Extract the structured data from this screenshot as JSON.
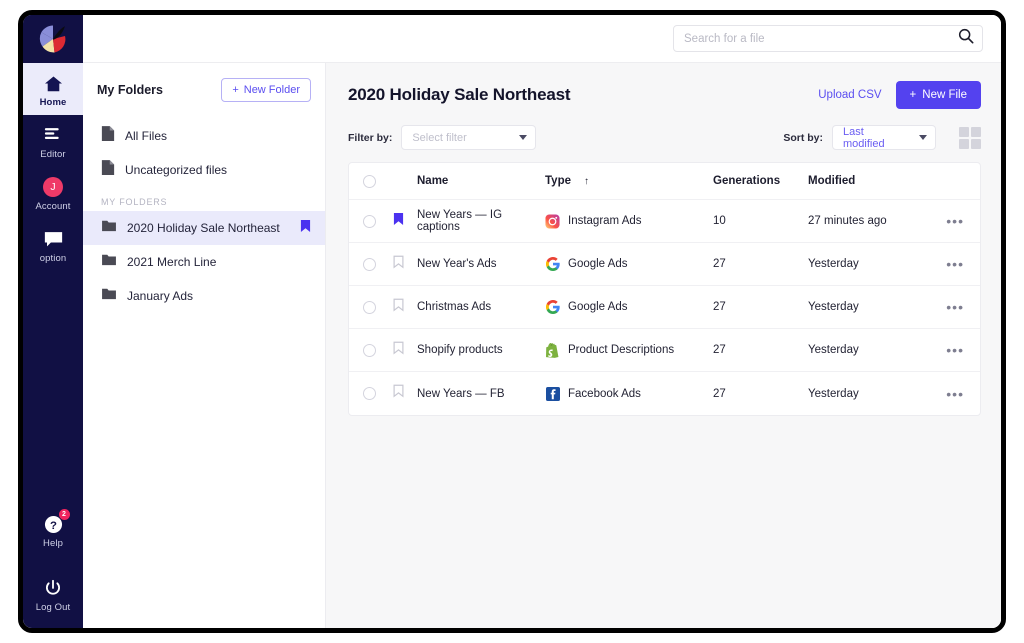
{
  "brand": {
    "logo_name": "app-logo",
    "colors": {
      "rail_bg": "#111044",
      "accent": "#5442ef",
      "accent_light": "#eaeafb",
      "avatar": "#ef3a68",
      "badge": "#f0245e"
    }
  },
  "rail": {
    "items": [
      {
        "label": "Home",
        "icon": "home-icon",
        "active": true
      },
      {
        "label": "Editor",
        "icon": "editor-icon",
        "active": false
      },
      {
        "label": "Account",
        "icon": "avatar-icon",
        "active": false,
        "avatar_initial": "J"
      },
      {
        "label": "option",
        "icon": "chat-icon",
        "active": false
      }
    ],
    "bottom_items": [
      {
        "label": "Help",
        "icon": "help-icon",
        "badge": "2"
      },
      {
        "label": "Log Out",
        "icon": "power-icon",
        "badge": ""
      }
    ]
  },
  "search": {
    "placeholder": "Search for a file",
    "value": "",
    "icon": "search-icon"
  },
  "folders_panel": {
    "title": "My Folders",
    "new_folder_label": "New Folder",
    "new_folder_plus": "+",
    "quick_items": [
      {
        "label": "All Files",
        "icon": "file-icon"
      },
      {
        "label": "Uncategorized files",
        "icon": "file-icon"
      }
    ],
    "section_label": "MY FOLDERS",
    "folders": [
      {
        "label": "2020 Holiday Sale Northeast",
        "icon": "folder-icon",
        "selected": true,
        "bookmarked": true
      },
      {
        "label": "2021 Merch Line",
        "icon": "folder-icon",
        "selected": false,
        "bookmarked": false
      },
      {
        "label": "January Ads",
        "icon": "folder-icon",
        "selected": false,
        "bookmarked": false
      }
    ]
  },
  "main": {
    "page_title": "2020 Holiday Sale Northeast",
    "upload_csv_label": "Upload CSV",
    "new_file_label": "New File",
    "new_file_plus": "+",
    "filter": {
      "label": "Filter by:",
      "placeholder": "Select filter",
      "value": "Select filter"
    },
    "sort": {
      "label": "Sort by:",
      "value": "Last modified"
    },
    "grid_toggle_icon": "grid-view-icon",
    "table": {
      "columns": {
        "name": "Name",
        "type": "Type",
        "type_sort_indicator": "↑",
        "generations": "Generations",
        "modified": "Modified"
      },
      "rows": [
        {
          "name": "New Years — IG captions",
          "type": "Instagram Ads",
          "type_icon": "instagram-icon",
          "generations": "10",
          "modified": "27 minutes ago",
          "bookmarked": true,
          "more_label": "•••"
        },
        {
          "name": "New Year's Ads",
          "type": "Google Ads",
          "type_icon": "google-icon",
          "generations": "27",
          "modified": "Yesterday",
          "bookmarked": false,
          "more_label": "•••"
        },
        {
          "name": "Christmas Ads",
          "type": "Google Ads",
          "type_icon": "google-icon",
          "generations": "27",
          "modified": "Yesterday",
          "bookmarked": false,
          "more_label": "•••"
        },
        {
          "name": "Shopify products",
          "type": "Product Descriptions",
          "type_icon": "shopify-icon",
          "generations": "27",
          "modified": "Yesterday",
          "bookmarked": false,
          "more_label": "•••"
        },
        {
          "name": "New Years — FB",
          "type": "Facebook Ads",
          "type_icon": "facebook-icon",
          "generations": "27",
          "modified": "Yesterday",
          "bookmarked": false,
          "more_label": "•••"
        }
      ]
    }
  }
}
